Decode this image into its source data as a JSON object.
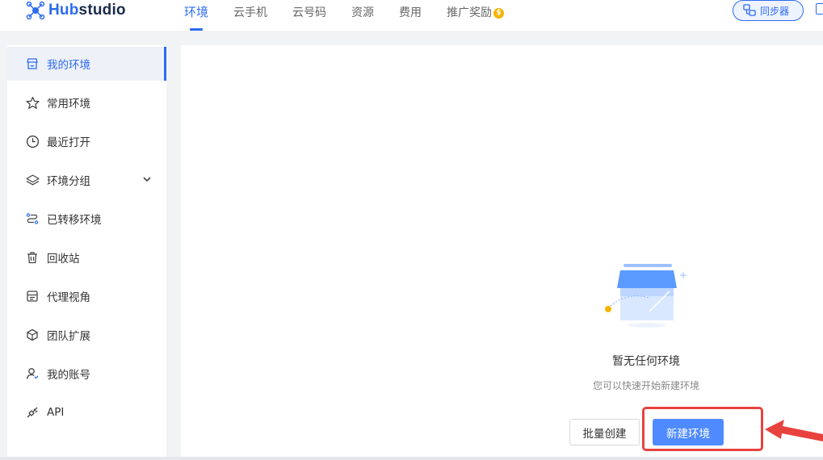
{
  "app": {
    "logo_text_prefix": "Hub",
    "logo_text_suffix": "studio"
  },
  "nav": {
    "items": [
      {
        "label": "环境",
        "active": true
      },
      {
        "label": "云手机",
        "active": false
      },
      {
        "label": "云号码",
        "active": false
      },
      {
        "label": "资源",
        "active": false
      },
      {
        "label": "费用",
        "active": false
      },
      {
        "label": "推广奖励",
        "active": false,
        "badge": "$"
      }
    ],
    "sync_label": "同步器"
  },
  "sidebar": {
    "items": [
      {
        "label": "我的环境",
        "icon": "store-icon",
        "active": true
      },
      {
        "label": "常用环境",
        "icon": "star-icon"
      },
      {
        "label": "最近打开",
        "icon": "clock-icon"
      },
      {
        "label": "环境分组",
        "icon": "layers-icon",
        "expandable": true
      },
      {
        "label": "已转移环境",
        "icon": "transfer-icon"
      },
      {
        "label": "回收站",
        "icon": "trash-icon"
      },
      {
        "label": "代理视角",
        "icon": "proxy-icon"
      },
      {
        "label": "团队扩展",
        "icon": "cube-icon"
      },
      {
        "label": "我的账号",
        "icon": "user-icon"
      },
      {
        "label": "API",
        "icon": "plug-icon"
      }
    ]
  },
  "main": {
    "empty_title": "暂无任何环境",
    "empty_subtitle": "您可以快速开始新建环境",
    "batch_create_label": "批量创建",
    "new_env_label": "新建环境"
  },
  "colors": {
    "accent": "#2d6bf0",
    "primary_button": "#4f8bff",
    "annotation_red": "#e8423f"
  }
}
